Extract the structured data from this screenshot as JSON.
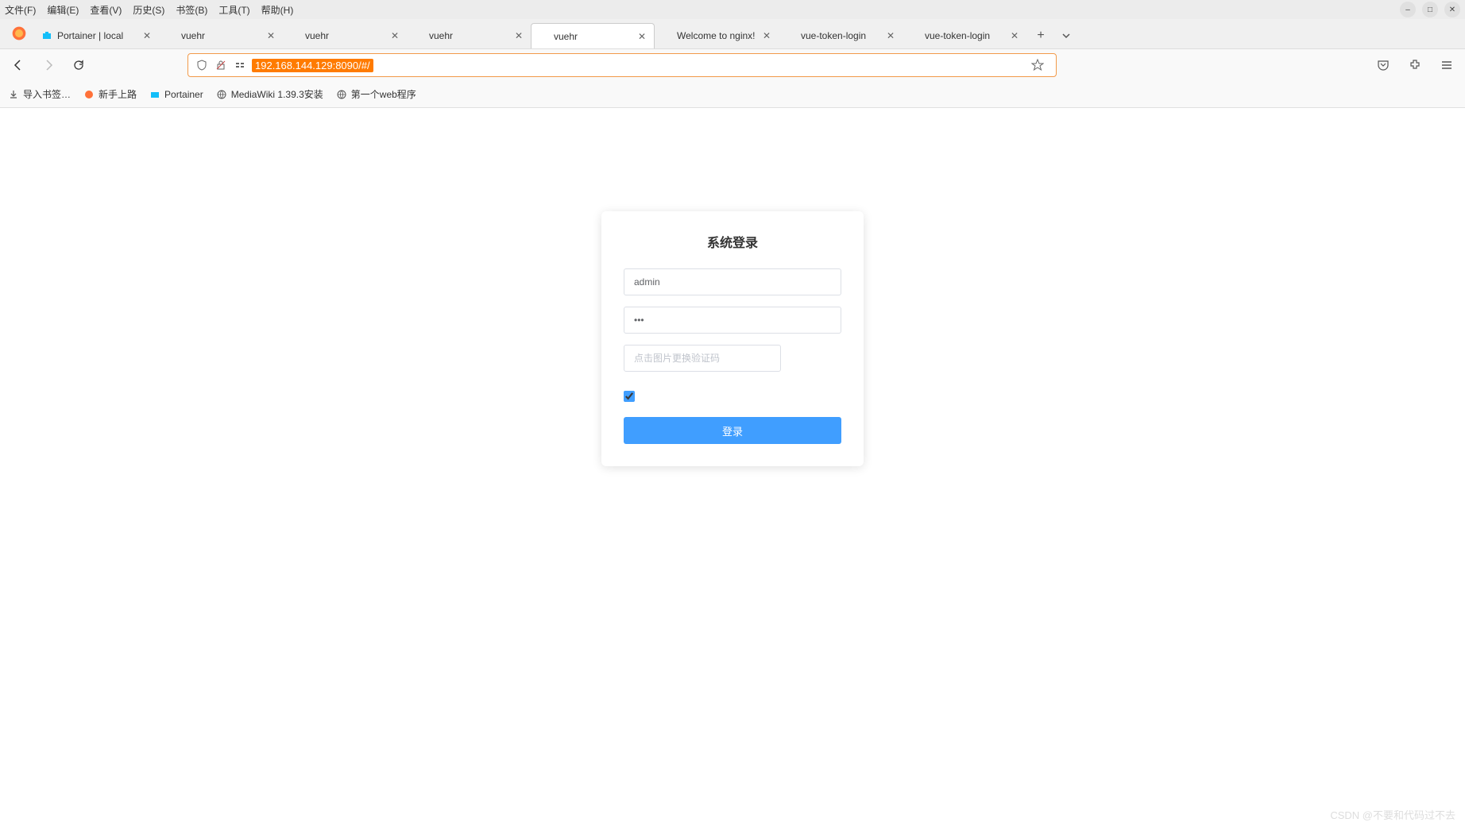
{
  "menu": {
    "file": "文件(F)",
    "edit": "编辑(E)",
    "view": "查看(V)",
    "history": "历史(S)",
    "bookmarks": "书签(B)",
    "tools": "工具(T)",
    "help": "帮助(H)"
  },
  "tabs": [
    {
      "title": "Portainer | local",
      "active": false,
      "favicon": "portainer"
    },
    {
      "title": "vuehr",
      "active": false,
      "favicon": "none"
    },
    {
      "title": "vuehr",
      "active": false,
      "favicon": "none"
    },
    {
      "title": "vuehr",
      "active": false,
      "favicon": "none"
    },
    {
      "title": "vuehr",
      "active": true,
      "favicon": "none"
    },
    {
      "title": "Welcome to nginx!",
      "active": false,
      "favicon": "none"
    },
    {
      "title": "vue-token-login",
      "active": false,
      "favicon": "none"
    },
    {
      "title": "vue-token-login",
      "active": false,
      "favicon": "none"
    }
  ],
  "urlbar": {
    "url": "192.168.144.129:8090/#/"
  },
  "bookmarks": [
    {
      "label": "导入书签…",
      "icon": "import"
    },
    {
      "label": "新手上路",
      "icon": "firefox"
    },
    {
      "label": "Portainer",
      "icon": "portainer"
    },
    {
      "label": "MediaWiki 1.39.3安装",
      "icon": "globe"
    },
    {
      "label": "第一个web程序",
      "icon": "globe"
    }
  ],
  "login": {
    "title": "系统登录",
    "username": "admin",
    "password": "•••",
    "captcha_placeholder": "点击图片更换验证码",
    "button": "登录"
  },
  "watermark": "CSDN @不要和代码过不去"
}
